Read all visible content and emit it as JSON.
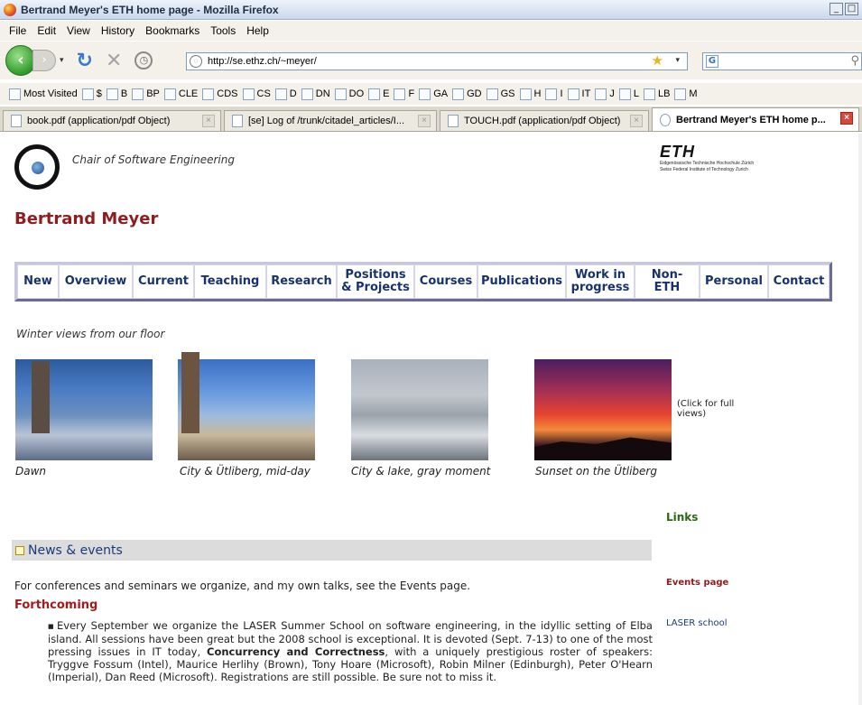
{
  "window": {
    "title": "Bertrand Meyer's ETH home page - Mozilla Firefox",
    "buttons": [
      "_",
      "□"
    ]
  },
  "menu": [
    "File",
    "Edit",
    "View",
    "History",
    "Bookmarks",
    "Tools",
    "Help"
  ],
  "toolbar": {
    "url": "http://se.ethz.ch/~meyer/",
    "search_engine": "G"
  },
  "bookmarks": [
    "Most Visited",
    "$",
    "B",
    "BP",
    "CLE",
    "CDS",
    "CS",
    "D",
    "DN",
    "DO",
    "E",
    "F",
    "GA",
    "GD",
    "GS",
    "H",
    "I",
    "IT",
    "J",
    "L",
    "LB",
    "M"
  ],
  "tabs": [
    {
      "label": "book.pdf (application/pdf Object)",
      "active": false
    },
    {
      "label": "[se] Log of /trunk/citadel_articles/I...",
      "active": false
    },
    {
      "label": "TOUCH.pdf (application/pdf Object)",
      "active": false
    },
    {
      "label": "Bertrand Meyer's ETH home p...",
      "active": true
    }
  ],
  "header": {
    "chair": "Chair of Software Engineering",
    "eth_logo": "ETH",
    "eth_line1": "Eidgenössische Technische Hochschule Zürich",
    "eth_line2": "Swiss Federal Institute of Technology Zurich",
    "person": "Bertrand Meyer"
  },
  "nav": [
    "New",
    "Overview",
    "Current",
    "Teaching",
    "Research",
    "Positions & Projects",
    "Courses",
    "Publications",
    "Work in progress",
    "Non-ETH",
    "Personal",
    "Contact"
  ],
  "gallery": {
    "title": "Winter views from our floor",
    "captions": [
      "Dawn",
      "City & Ütliberg, mid-day",
      "City & lake, gray moment",
      "Sunset on the Ütliberg"
    ],
    "note": "(Click for full views)"
  },
  "sidebar": {
    "links_title": "Links",
    "events": "Events page",
    "laser": "LASER school"
  },
  "news": {
    "title": "News & events",
    "intro": "For conferences and seminars we organize, and my own talks, see the Events page.",
    "forthcoming": "Forthcoming",
    "p1": "Every September we organize the LASER Summer School on software engineering, in the idyllic setting of Elba island. All sessions have been great but the 2008 school is exceptional. It is devoted (Sept. 7-13) to one of the most pressing issues in IT today, ",
    "p1_bold": "Concurrency and Correctness",
    "p2": ", with a uniquely prestigious roster of speakers: Tryggve Fossum (Intel), Maurice Herlihy (Brown), Tony Hoare (Microsoft), Robin Milner (Edinburgh), Peter O'Hearn (Imperial), Dan Reed (Microsoft). Registrations are still possible. Be sure not to miss it."
  }
}
